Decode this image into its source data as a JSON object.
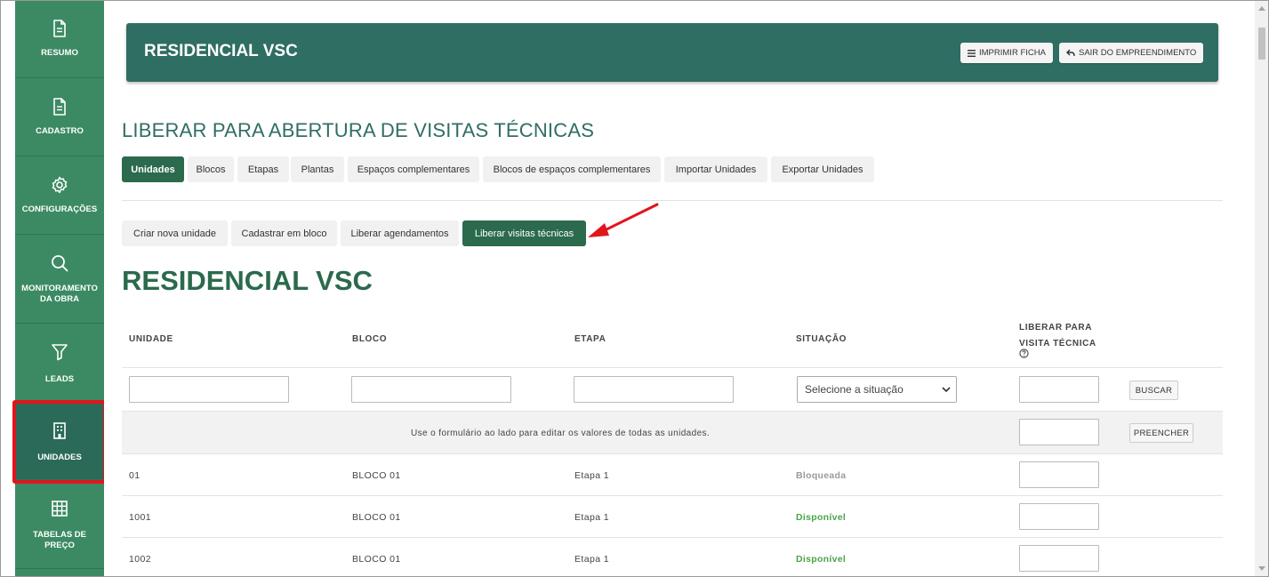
{
  "sidebar": {
    "items": [
      {
        "label": "RESUMO",
        "icon": "document-icon"
      },
      {
        "label": "CADASTRO",
        "icon": "document-icon"
      },
      {
        "label": "CONFIGURAÇÕES",
        "icon": "gear-icon"
      },
      {
        "label_line1": "MONITORAMENTO",
        "label_line2": "DA OBRA",
        "icon": "search-icon"
      },
      {
        "label": "LEADS",
        "icon": "funnel-icon"
      },
      {
        "label": "UNIDADES",
        "icon": "building-icon",
        "active": true
      },
      {
        "label_line1": "TABELAS DE",
        "label_line2": "PREÇO",
        "icon": "grid-icon"
      }
    ]
  },
  "header": {
    "title": "RESIDENCIAL VSC",
    "print_label": "IMPRIMIR FICHA",
    "exit_label": "SAIR DO EMPREENDIMENTO"
  },
  "page_title": "LIBERAR PARA ABERTURA DE VISITAS TÉCNICAS",
  "tabs": [
    "Unidades",
    "Blocos",
    "Etapas",
    "Plantas",
    "Espaços complementares",
    "Blocos de espaços complementares",
    "Importar Unidades",
    "Exportar Unidades"
  ],
  "subtabs": [
    "Criar nova unidade",
    "Cadastrar em bloco",
    "Liberar agendamentos",
    "Liberar visitas técnicas"
  ],
  "section_title": "RESIDENCIAL VSC",
  "table": {
    "headers": {
      "unidade": "UNIDADE",
      "bloco": "BLOCO",
      "etapa": "ETAPA",
      "situacao": "SITUAÇÃO",
      "liberar_line1": "LIBERAR PARA",
      "liberar_line2": "VISITA TÉCNICA"
    },
    "filter": {
      "situacao_placeholder": "Selecione a situação",
      "search_label": "BUSCAR"
    },
    "bulk": {
      "message": "Use o formulário ao lado para editar os valores de todas as unidades.",
      "fill_label": "PREENCHER"
    },
    "rows": [
      {
        "unidade": "01",
        "bloco": "BLOCO 01",
        "etapa": "Etapa 1",
        "situacao": "Bloqueada"
      },
      {
        "unidade": "1001",
        "bloco": "BLOCO 01",
        "etapa": "Etapa 1",
        "situacao": "Disponível"
      },
      {
        "unidade": "1002",
        "bloco": "BLOCO 01",
        "etapa": "Etapa 1",
        "situacao": "Disponível"
      }
    ]
  },
  "colors": {
    "sidebar_green": "#3c8a63",
    "header_green": "#2f6e63",
    "active_green": "#2b6a4c",
    "available_green": "#4aa34a",
    "blocked_gray": "#9a9a9a",
    "highlight_red": "#e0161c"
  }
}
